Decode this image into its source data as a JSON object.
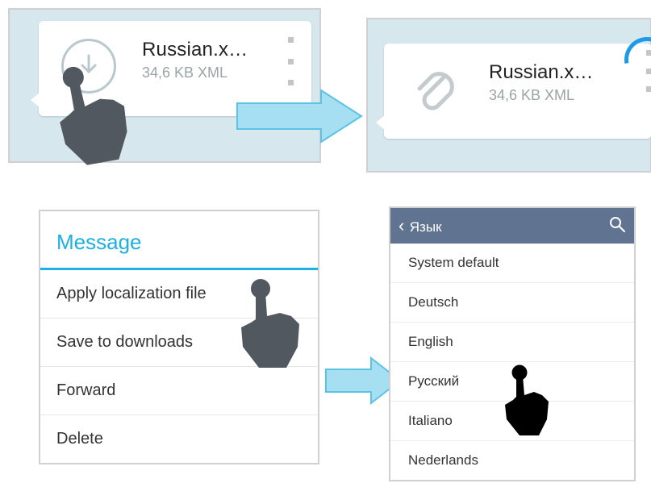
{
  "file": {
    "name": "Russian.x…",
    "meta": "34,6 KB XML"
  },
  "message_menu": {
    "title": "Message",
    "items": [
      "Apply localization file",
      "Save to downloads",
      "Forward",
      "Delete"
    ]
  },
  "language_screen": {
    "back_label": "Язык",
    "options": [
      "System default",
      "Deutsch",
      "English",
      "Русский",
      "Italiano",
      "Nederlands"
    ]
  }
}
